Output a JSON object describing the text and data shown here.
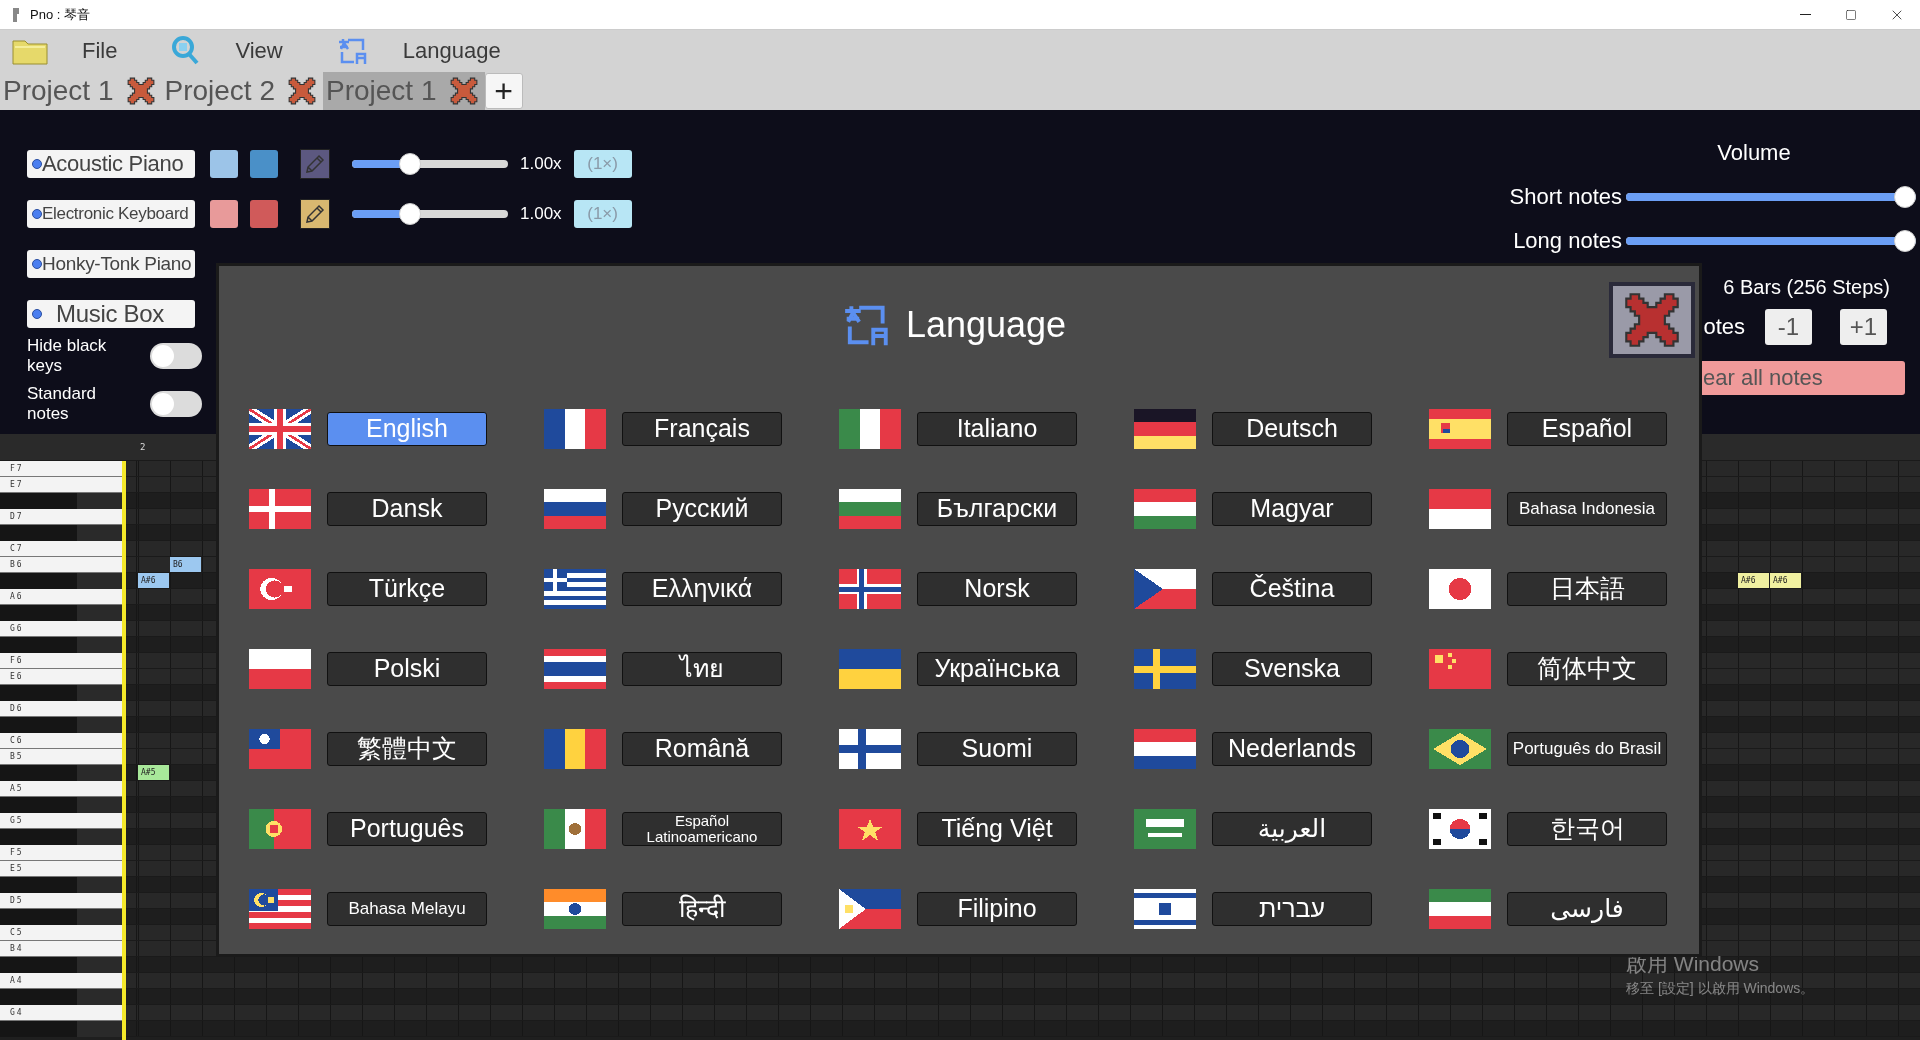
{
  "window": {
    "title": "Pno : 琴音"
  },
  "menu": [
    {
      "label": "File",
      "kind": "folder"
    },
    {
      "label": "View",
      "kind": "search"
    },
    {
      "label": "Language",
      "kind": "language"
    }
  ],
  "tabs": [
    {
      "label": "Project 1",
      "selected": false
    },
    {
      "label": "Project 2",
      "selected": false
    },
    {
      "label": "Project 1",
      "selected": true
    }
  ],
  "new_tab": "+",
  "instruments": [
    {
      "name": "Acoustic Piano",
      "kind": "full",
      "swatches": [
        {
          "color": "#9cc4e8"
        },
        {
          "color": "#4a90c8"
        }
      ],
      "selected": false,
      "level": 0.35,
      "speed": "1.00x",
      "reset": "(1×)"
    },
    {
      "name": "Electronic Keyboard",
      "kind": "full",
      "swatches": [
        {
          "color": "#e89a9a"
        },
        {
          "color": "#d05a5a"
        }
      ],
      "selected": true,
      "level": 0.35,
      "speed": "1.00x",
      "reset": "(1×)"
    },
    {
      "name": "Honky-Tonk Piano",
      "kind": "name_only"
    },
    {
      "name": "Music Box",
      "kind": "name_only"
    }
  ],
  "toggles": [
    {
      "label": "Hide black keys",
      "on": false
    },
    {
      "label": "Standard notes",
      "on": false
    }
  ],
  "volume": {
    "title": "Volume",
    "sliders": [
      {
        "label": "Short notes",
        "level": 1
      },
      {
        "label": "Long notes",
        "level": 1
      }
    ]
  },
  "length_text": "6 Bars (256 Steps)",
  "notes_row": {
    "label": "otes",
    "buttons": [
      "-1",
      "+1"
    ]
  },
  "clear_button": "ear all notes",
  "ruler": {
    "label": "2"
  },
  "keys": [
    {
      "label": "F7",
      "kind": "white"
    },
    {
      "label": "E7",
      "kind": "white"
    },
    {
      "kind": "black"
    },
    {
      "label": "D7",
      "kind": "white"
    },
    {
      "kind": "black"
    },
    {
      "label": "C7",
      "kind": "white"
    },
    {
      "label": "B6",
      "kind": "white",
      "notes": [
        {
          "label": "B6",
          "color": "#9cc8f0"
        }
      ]
    },
    {
      "kind": "black",
      "notes": [
        {
          "label": "A#6",
          "color": "#9cc8f0"
        },
        {
          "label": "A#6",
          "color": "#f0f0a0"
        },
        {
          "label": "A#6",
          "color": "#f0f0a0"
        }
      ]
    },
    {
      "label": "A6",
      "kind": "white"
    },
    {
      "kind": "black"
    },
    {
      "label": "G6",
      "kind": "white"
    },
    {
      "kind": "black"
    },
    {
      "label": "F6",
      "kind": "white"
    },
    {
      "label": "E6",
      "kind": "white"
    },
    {
      "kind": "black"
    },
    {
      "label": "D6",
      "kind": "white"
    },
    {
      "kind": "black"
    },
    {
      "label": "C6",
      "kind": "white"
    },
    {
      "label": "B5",
      "kind": "white"
    },
    {
      "kind": "black",
      "notes": [
        {
          "label": "A#5",
          "color": "#a8e89a"
        }
      ]
    },
    {
      "label": "A5",
      "kind": "white"
    },
    {
      "kind": "black"
    },
    {
      "label": "G5",
      "kind": "white"
    },
    {
      "kind": "black"
    },
    {
      "label": "F5",
      "kind": "white"
    },
    {
      "label": "E5",
      "kind": "white"
    },
    {
      "kind": "black"
    },
    {
      "label": "D5",
      "kind": "white"
    },
    {
      "kind": "black"
    },
    {
      "label": "C5",
      "kind": "white"
    },
    {
      "label": "B4",
      "kind": "white"
    },
    {
      "kind": "black"
    },
    {
      "label": "A4",
      "kind": "white"
    },
    {
      "kind": "black"
    },
    {
      "label": "G4",
      "kind": "white"
    },
    {
      "kind": "black"
    }
  ],
  "dialog": {
    "title": "Language",
    "languages": [
      {
        "label": "English",
        "selected": true
      },
      {
        "label": "Français",
        "selected": false
      },
      {
        "label": "Italiano",
        "selected": false
      },
      {
        "label": "Deutsch",
        "selected": false
      },
      {
        "label": "Español",
        "selected": false
      },
      {
        "label": "Dansk",
        "selected": false
      },
      {
        "label": "Русский",
        "selected": false
      },
      {
        "label": "Български",
        "selected": false
      },
      {
        "label": "Magyar",
        "selected": false
      },
      {
        "label": "Bahasa Indonesia",
        "selected": false
      },
      {
        "label": "Türkçe",
        "selected": false
      },
      {
        "label": "Ελληνικά",
        "selected": false
      },
      {
        "label": "Norsk",
        "selected": false
      },
      {
        "label": "Čeština",
        "selected": false
      },
      {
        "label": "日本語",
        "selected": false
      },
      {
        "label": "Polski",
        "selected": false
      },
      {
        "label": "ไทย",
        "selected": false
      },
      {
        "label": "Українська",
        "selected": false
      },
      {
        "label": "Svenska",
        "selected": false
      },
      {
        "label": "简体中文",
        "selected": false
      },
      {
        "label": "繁體中文",
        "selected": false
      },
      {
        "label": "Română",
        "selected": false
      },
      {
        "label": "Suomi",
        "selected": false
      },
      {
        "label": "Nederlands",
        "selected": false
      },
      {
        "label": "Português do Brasil",
        "selected": false
      },
      {
        "label": "Português",
        "selected": false
      },
      {
        "label": "Español Latinoamericano",
        "selected": false
      },
      {
        "label": "Tiếng Việt",
        "selected": false
      },
      {
        "label": "العربية",
        "selected": false
      },
      {
        "label": "한국어",
        "selected": false
      },
      {
        "label": "Bahasa Melayu",
        "selected": false
      },
      {
        "label": "हिन्दी",
        "selected": false
      },
      {
        "label": "Filipino",
        "selected": false
      },
      {
        "label": "עברית",
        "selected": false
      },
      {
        "label": "فارسی",
        "selected": false
      }
    ]
  },
  "os_notice": {
    "title": "啟用 Windows",
    "text": "移至 [設定] 以啟用 Windows。"
  }
}
